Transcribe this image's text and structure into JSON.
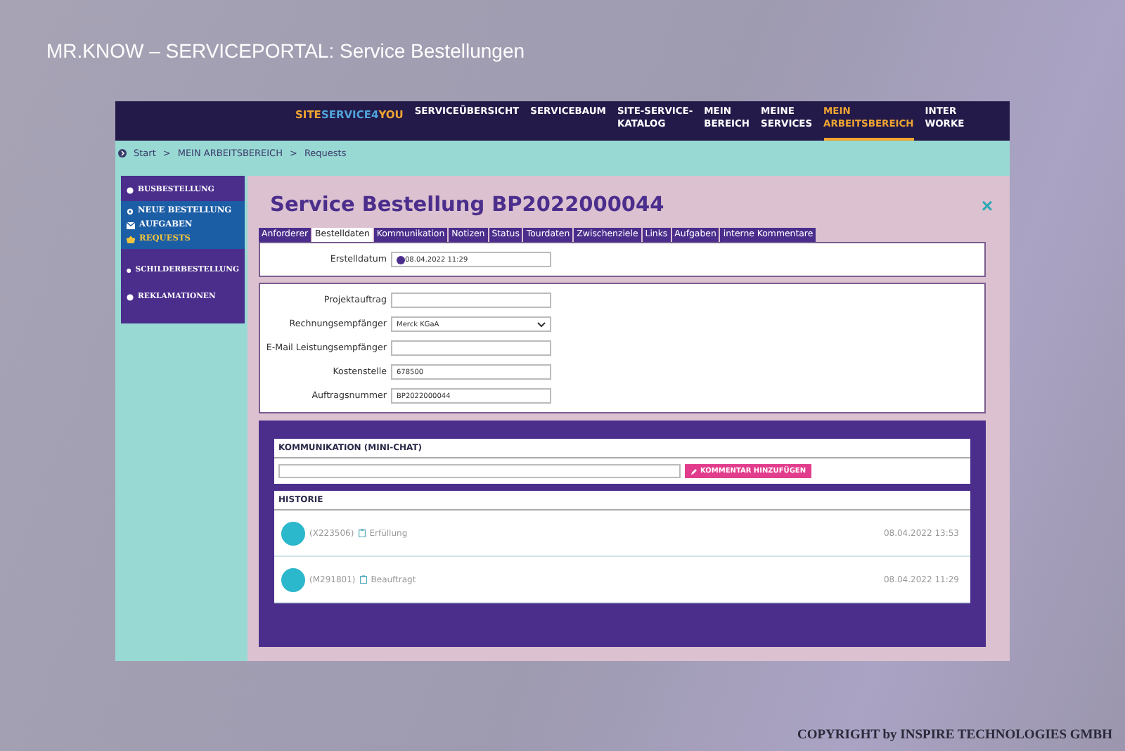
{
  "slide_title": "MR.KNOW – SERVICEPORTAL: Service Bestellungen",
  "nav": {
    "logo": [
      {
        "text": "SITE",
        "color": "#f0a531"
      },
      {
        "text": "SERVICE4",
        "color": "#4fa3d9"
      },
      {
        "text": "YOU",
        "color": "#f0a531"
      }
    ],
    "items": [
      {
        "lines": [
          "SERVICEÜBERSICHT"
        ],
        "selected": false
      },
      {
        "lines": [
          "SERVICEBAUM"
        ],
        "selected": false
      },
      {
        "lines": [
          "SITE-SERVICE-",
          "KATALOG"
        ],
        "selected": false
      },
      {
        "lines": [
          "MEIN",
          "BEREICH"
        ],
        "selected": false
      },
      {
        "lines": [
          "MEINE",
          "SERVICES"
        ],
        "selected": false
      },
      {
        "lines": [
          "MEIN",
          "ARBEITSBEREICH"
        ],
        "selected": true
      },
      {
        "lines": [
          "INTER",
          "WORKE"
        ],
        "selected": false
      }
    ]
  },
  "breadcrumb": {
    "separator": ">",
    "items": [
      "Start",
      "MEIN ARBEITSBEREICH",
      "Requests"
    ]
  },
  "sidebar": {
    "items": [
      {
        "label": "BUSBESTELLUNG",
        "children": [
          {
            "label": "NEUE BESTELLUNG",
            "selected": false
          },
          {
            "label": "AUFGABEN",
            "selected": false
          },
          {
            "label": "REQUESTS",
            "selected": true
          }
        ]
      },
      {
        "label": "SCHILDERBESTELLUNG"
      },
      {
        "label": "REKLAMATIONEN"
      }
    ]
  },
  "page": {
    "title": "Service Bestellung BP2022000044",
    "close": "×"
  },
  "tabs": [
    {
      "label": "Anforderer",
      "selected": false
    },
    {
      "label": "Bestelldaten",
      "selected": true
    },
    {
      "label": "Kommunikation",
      "selected": false
    },
    {
      "label": "Notizen",
      "selected": false
    },
    {
      "label": "Status",
      "selected": false
    },
    {
      "label": "Tourdaten",
      "selected": false
    },
    {
      "label": "Zwischenziele",
      "selected": false
    },
    {
      "label": "Links",
      "selected": false
    },
    {
      "label": "Aufgaben",
      "selected": false
    },
    {
      "label": "interne Kommentare",
      "selected": false
    }
  ],
  "panels": [
    {
      "fields": [
        {
          "label": "Erstelldatum",
          "kind": "date",
          "value": "08.04.2022 11:29"
        }
      ]
    },
    {
      "fields": [
        {
          "label": "Projektauftrag",
          "kind": "text"
        },
        {
          "label": "Rechnungsempfänger",
          "kind": "select",
          "value": "Merck KGaA"
        },
        {
          "label": "E-Mail Leistungsempfänger",
          "kind": "text"
        },
        {
          "label": "Kostenstelle",
          "kind": "text",
          "value": "678500"
        },
        {
          "label": "Auftragsnummer",
          "kind": "text",
          "value": "BP2022000044"
        }
      ]
    }
  ],
  "chat": {
    "title": "KOMMUNIKATION (MINI-CHAT)",
    "button": "KOMMENTAR HINZUFÜGEN"
  },
  "history": {
    "title": "HISTORIE",
    "entries": [
      {
        "user": "(X223506)",
        "status": "Erfüllung",
        "time": "08.04.2022 13:53"
      },
      {
        "user": "(M291801)",
        "status": "Beauftragt",
        "time": "08.04.2022 11:29"
      }
    ]
  },
  "copyright": "COPYRIGHT by INSPIRE TECHNOLOGIES GMBH"
}
